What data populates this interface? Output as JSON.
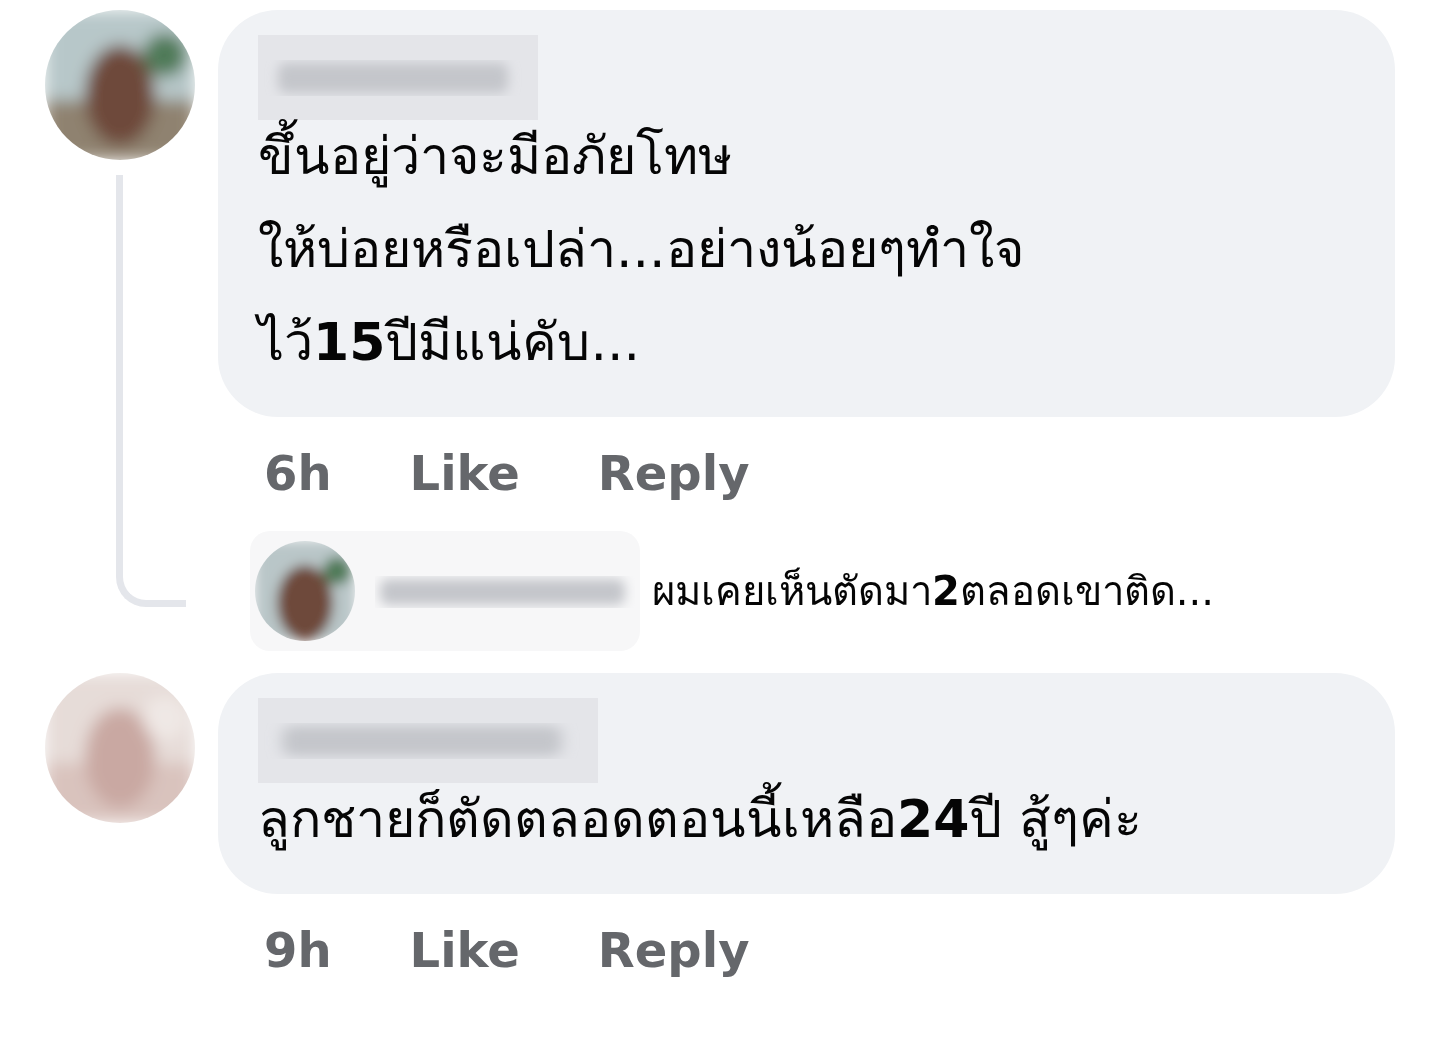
{
  "comments": [
    {
      "avatar": {
        "kind": "picture"
      },
      "text": "ขึ้นอยู่ว่าจะมีอภัยโทษ\nให้บ่อยหรือเปล่า...อย่างน้อยๆทำใจ\nไว้**15**ปีมีแน่คับ...",
      "time": "6h",
      "like": "Like",
      "reply": "Reply",
      "replies": [
        {
          "avatar": {
            "kind": "picture"
          },
          "text": "ผมเคยเห็นตัดมา**2**ตลอดเขาติด..."
        }
      ]
    },
    {
      "avatar": {
        "kind": "picture"
      },
      "text": "ลูกชายก็ตัดตลอดตอนนี้เหลือ**24**ปี สู้ๆค่ะ",
      "time": "9h",
      "like": "Like",
      "reply": "Reply"
    }
  ]
}
